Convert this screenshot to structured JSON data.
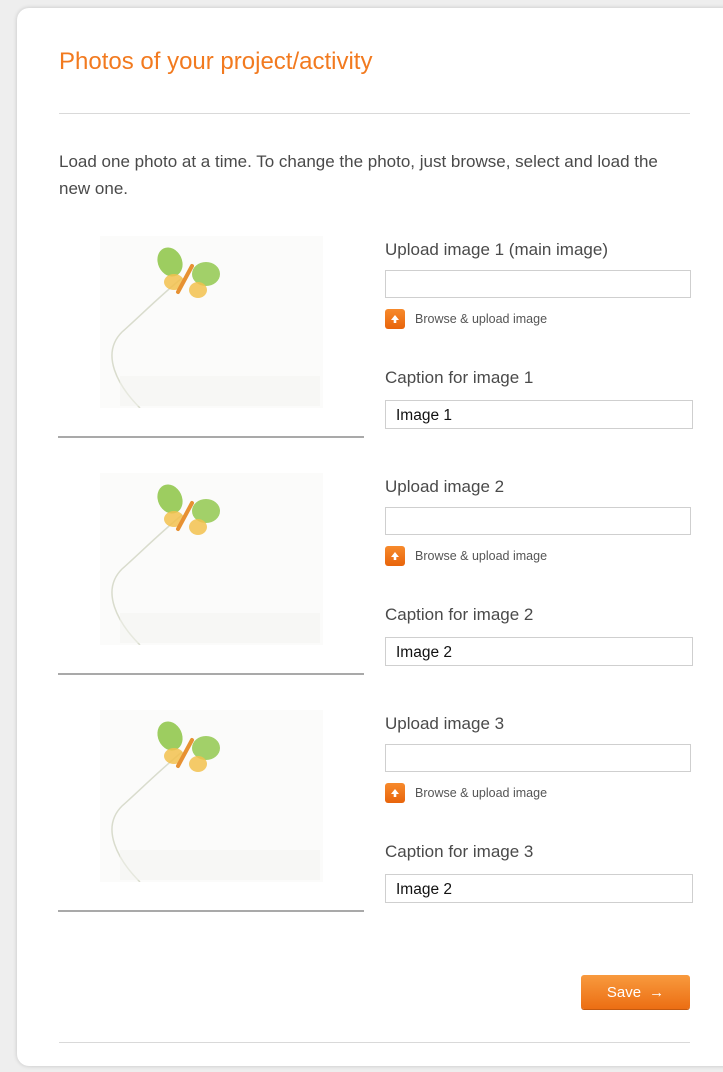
{
  "form": {
    "title": "Photos of your project/activity",
    "instructions": "Load one photo at a time. To change the photo, just browse, select and load the new one.",
    "upload_button_label": "Browse & upload image",
    "save_label": "Save",
    "save_arrow": "→"
  },
  "photos": [
    {
      "upload_label": "Upload image 1 (main image)",
      "file_value": "",
      "caption_label": "Caption for image 1",
      "caption_value": "Image 1"
    },
    {
      "upload_label": "Upload image 2",
      "file_value": "",
      "caption_label": "Caption for image 2",
      "caption_value": "Image 2"
    },
    {
      "upload_label": "Upload image 3",
      "file_value": "",
      "caption_label": "Caption for image 3",
      "caption_value": "Image 2"
    }
  ],
  "icons": {
    "upload": "upload-arrow-icon",
    "placeholder": "butterfly-flower-placeholder-icon",
    "save_arrow": "arrow-right-icon"
  },
  "colors": {
    "accent": "#f27a1f",
    "text": "#4a4a4a",
    "button_top": "#f89a3e",
    "button_bottom": "#ec6e13"
  }
}
